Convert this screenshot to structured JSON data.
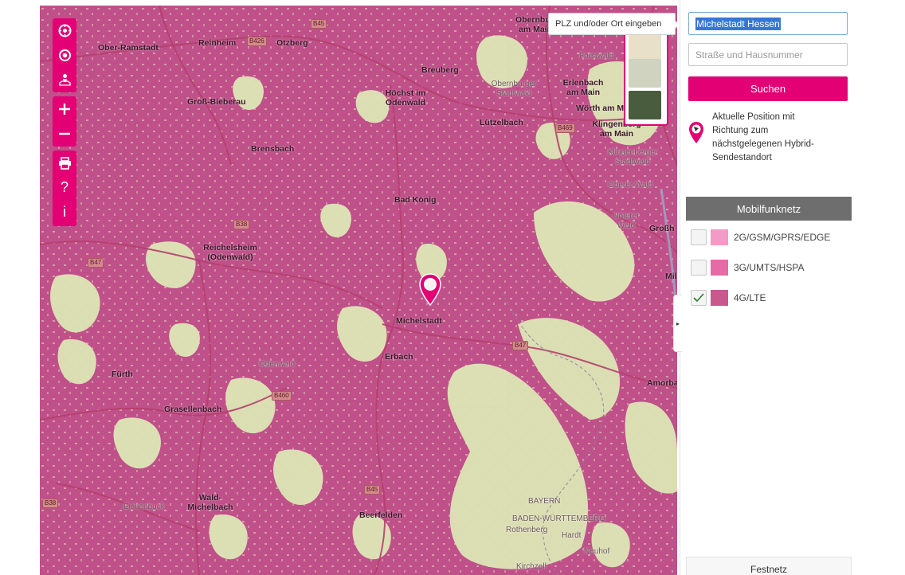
{
  "search": {
    "tooltip": "PLZ und/oder Ort eingeben",
    "location_value": "Michelstadt Hessen",
    "street_placeholder": "Straße und Hausnummer",
    "search_label": "Suchen"
  },
  "position_hint": "Aktuelle Position mit Richtung zum nächstgelegenen Hybrid-Sendestandort",
  "mobile_section": {
    "title": "Mobilfunknetz",
    "legend": [
      {
        "label": "2G/GSM/GPRS/EDGE",
        "color": "#f49ac6",
        "checked": false
      },
      {
        "label": "3G/UMTS/HSPA",
        "color": "#e56aa6",
        "checked": false
      },
      {
        "label": "4G/LTE",
        "color": "#c9588f",
        "checked": true
      }
    ]
  },
  "fixed_section": {
    "title": "Festnetz"
  },
  "map": {
    "coverage_color": "#c0508a",
    "gap_color": "#dce6b4",
    "places": [
      {
        "name": "Ober-Ramstadt",
        "style": "town"
      },
      {
        "name": "Reinheim",
        "style": "town"
      },
      {
        "name": "Otzberg",
        "style": "town"
      },
      {
        "name": "Breuberg",
        "style": "town"
      },
      {
        "name": "Höchst im Odenwald",
        "style": "town"
      },
      {
        "name": "Groß-Bieberau",
        "style": "town"
      },
      {
        "name": "Lützelbach",
        "style": "town"
      },
      {
        "name": "Erlenbach am Main",
        "style": "town"
      },
      {
        "name": "Wörth am Main",
        "style": "town"
      },
      {
        "name": "Klingenberg am Main",
        "style": "town"
      },
      {
        "name": "Obernburg am Main",
        "style": "town"
      },
      {
        "name": "Brensbach",
        "style": "town"
      },
      {
        "name": "Bad König",
        "style": "town"
      },
      {
        "name": "Reichelsheim (Odenwald)",
        "style": "town"
      },
      {
        "name": "Michelstadt",
        "style": "town"
      },
      {
        "name": "Erbach",
        "style": "town"
      },
      {
        "name": "Fürth",
        "style": "town"
      },
      {
        "name": "Grasellenbach",
        "style": "town"
      },
      {
        "name": "Wald-Michelbach",
        "style": "town"
      },
      {
        "name": "Beerfelden",
        "style": "town"
      },
      {
        "name": "Amorba",
        "style": "town"
      },
      {
        "name": "Großh",
        "style": "town"
      },
      {
        "name": "Mil",
        "style": "town"
      },
      {
        "name": "Forstwald",
        "style": "minor"
      },
      {
        "name": "Obernburger Stadtwald",
        "style": "minor"
      },
      {
        "name": "Klingenberger Stadtwald",
        "style": "minor"
      },
      {
        "name": "Oberer Wald",
        "style": "minor"
      },
      {
        "name": "Unterer Wald",
        "style": "minor"
      },
      {
        "name": "Odenwald",
        "style": "minor"
      },
      {
        "name": "BAYERN",
        "style": "minor"
      },
      {
        "name": "BADEN-WÜRTTEMBERG",
        "style": "minor"
      },
      {
        "name": "Rothenberg",
        "style": "minor"
      },
      {
        "name": "Eichenbuck",
        "style": "minor"
      },
      {
        "name": "Hardt",
        "style": "minor"
      },
      {
        "name": "Neuhof",
        "style": "minor"
      },
      {
        "name": "Kirchzell",
        "style": "minor"
      }
    ],
    "roads": [
      "B426",
      "B45",
      "B38",
      "B47",
      "B469",
      "B460",
      "B45",
      "B47",
      "B38"
    ]
  },
  "icons": [
    "compass-icon",
    "locate-icon",
    "map-person-icon",
    "zoom-in-icon",
    "zoom-out-icon",
    "print-icon",
    "help-icon",
    "info-icon",
    "location-pin-icon"
  ]
}
